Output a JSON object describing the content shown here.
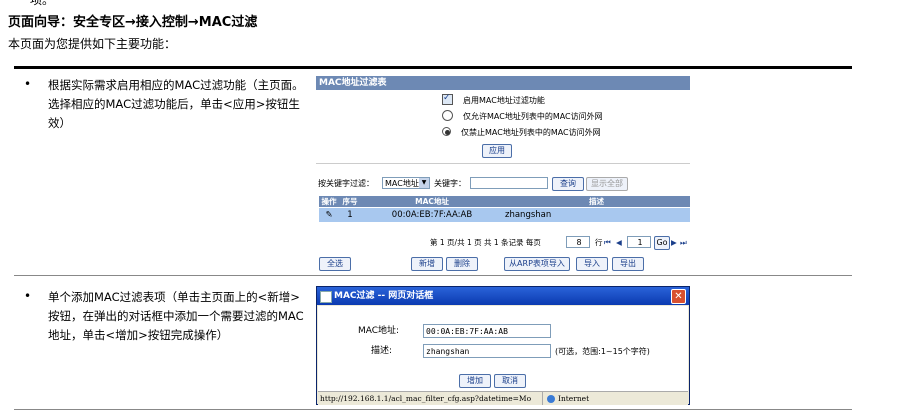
{
  "top_fragment": "项。",
  "nav_heading": "页面向导：安全专区→接入控制→MAC过滤",
  "intro": "本页面为您提供如下主要功能：",
  "bullets": [
    {
      "text": "根据实际需求启用相应的MAC过滤功能（主页面。选择相应的MAC过滤功能后，单击<应用>按钮生效）"
    },
    {
      "text": "单个添加MAC过滤表项（单击主页面上的<新增>按钮，在弹出的对话框中添加一个需要过滤的MAC地址，单击<增加>按钮完成操作）"
    }
  ],
  "panel": {
    "title": "MAC地址过滤表",
    "enable_label": "启用MAC地址过滤功能",
    "allow_label": "仅允许MAC地址列表中的MAC访问外网",
    "deny_label": "仅禁止MAC地址列表中的MAC访问外网",
    "apply": "应用",
    "filter_label": "按关键字过滤：",
    "filter_select": "MAC地址",
    "keyword_label": "关键字：",
    "keyword_value": "",
    "query": "查询",
    "show_all": "显示全部",
    "columns": {
      "op": "操作",
      "no": "序号",
      "mac": "MAC地址",
      "desc": "描述"
    },
    "rows": [
      {
        "no": "1",
        "mac": "00:0A:EB:7F:AA:AB",
        "desc": "zhangshan"
      }
    ],
    "paging": {
      "text": "第 1 页/共 1 页 共 1 条记录 每页",
      "per_page": "8",
      "goto_label": "行",
      "page_input": "1",
      "go": "Go"
    },
    "buttons": {
      "select_all": "全选",
      "add": "新增",
      "delete": "删除",
      "import_arp": "从ARP表项导入",
      "import": "导入",
      "export": "导出"
    }
  },
  "dialog": {
    "title": "MAC过滤 -- 网页对话框",
    "mac_label": "MAC地址:",
    "mac_value": "00:0A:EB:7F:AA:AB",
    "desc_label": "描述:",
    "desc_value": "zhangshan",
    "desc_hint": "(可选，范围:1~15个字符)",
    "add": "增加",
    "cancel": "取消",
    "status_url": "http://192.168.1.1/acl_mac_filter_cfg.asp?datetime=Mo",
    "status_zone": "Internet"
  }
}
